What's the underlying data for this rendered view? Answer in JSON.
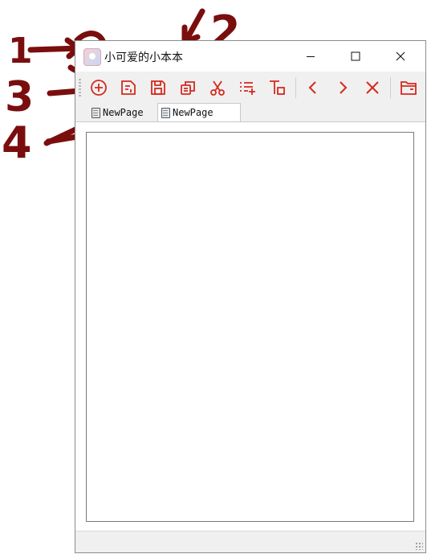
{
  "window": {
    "title": "小可爱的小本本",
    "icon": "app-icon"
  },
  "window_controls": [
    "minimize-icon",
    "maximize-icon",
    "close-icon"
  ],
  "toolbar": {
    "buttons": [
      {
        "name": "new",
        "icon": "plus-circle-icon"
      },
      {
        "name": "open-file",
        "icon": "file-icon"
      },
      {
        "name": "save",
        "icon": "save-icon"
      },
      {
        "name": "copy",
        "icon": "copy-icon"
      },
      {
        "name": "cut",
        "icon": "scissors-icon"
      },
      {
        "name": "insert-list",
        "icon": "list-add-icon"
      },
      {
        "name": "text-format",
        "icon": "text-format-icon"
      },
      {
        "name": "previous",
        "icon": "chevron-left-icon"
      },
      {
        "name": "next",
        "icon": "chevron-right-icon"
      },
      {
        "name": "close-tab",
        "icon": "close-icon"
      },
      {
        "name": "folder",
        "icon": "folder-icon"
      }
    ],
    "accent_color": "#d42a1e"
  },
  "tabs": [
    {
      "label": "NewPage",
      "active": false
    },
    {
      "label": "NewPage",
      "active": true
    }
  ],
  "annotations": {
    "labels": [
      "1",
      "2",
      "3",
      "4"
    ],
    "color": "#7a0e0e"
  }
}
